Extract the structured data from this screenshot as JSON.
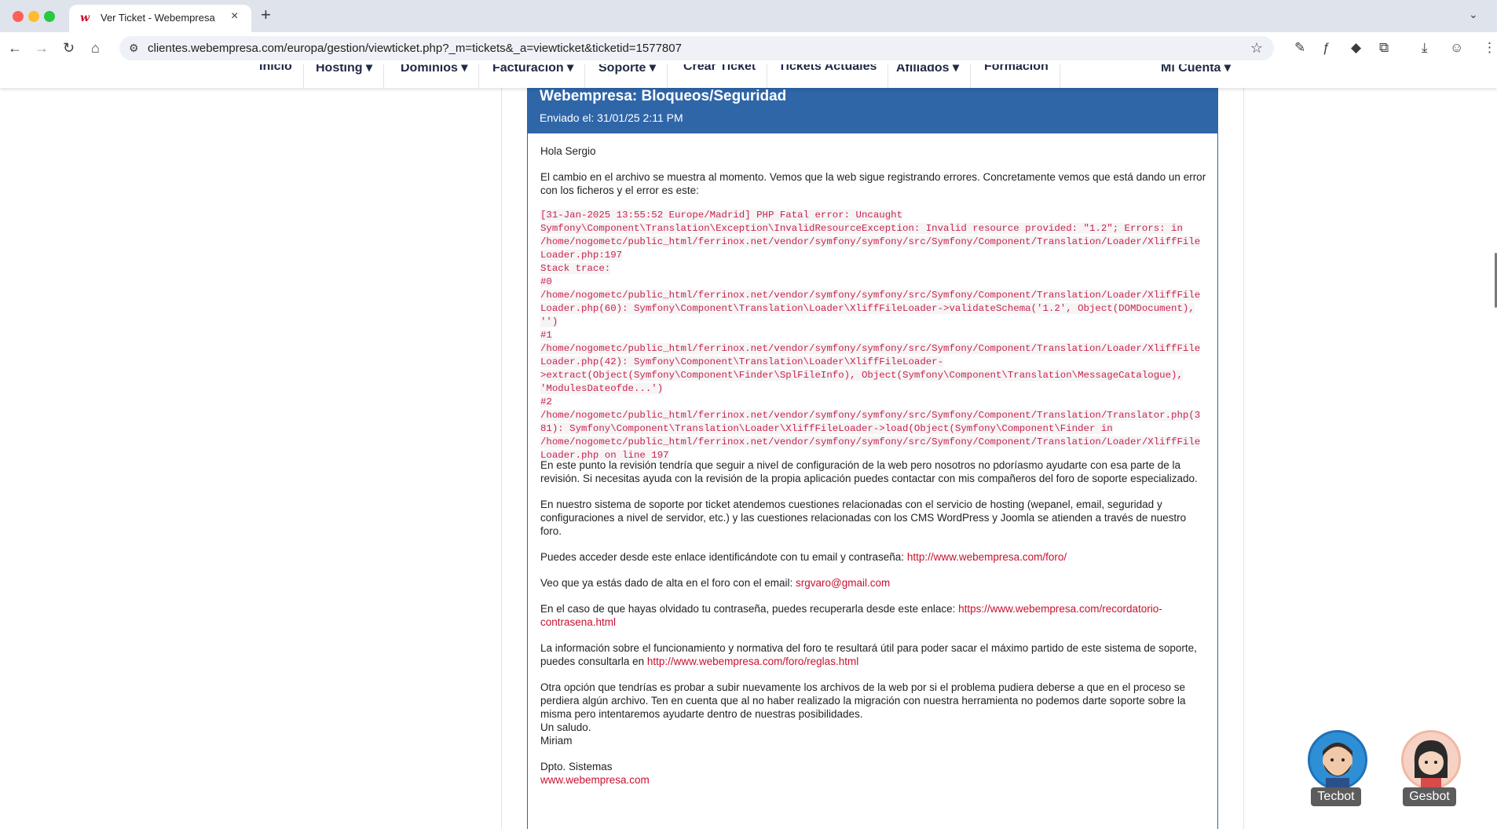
{
  "browser": {
    "tab_title": "Ver Ticket - Webempresa Europa",
    "tab_close": "×",
    "new_tab": "+",
    "url": "clientes.webempresa.com/europa/gestion/viewticket.php?_m=tickets&_a=viewticket&ticketid=1577807"
  },
  "site_nav": {
    "items": [
      "Inicio",
      "Hosting ▾",
      "Dominios ▾",
      "Facturación ▾",
      "Soporte ▾",
      "Crear Ticket",
      "Tickets Actuales",
      "Afiliados ▾",
      "Formación",
      "Mi Cuenta ▾"
    ]
  },
  "ticket": {
    "title": "Webempresa: Bloqueos/Seguridad",
    "sent": "Enviado el: 31/01/25 2:11 PM",
    "greeting": "Hola Sergio",
    "intro": "El cambio en el archivo se muestra al momento. Vemos que la web sigue registrando errores. Concretamente vemos que está dando un error con los ficheros y el error es este:",
    "code_lines": [
      "[31-Jan-2025 13:55:52 Europe/Madrid] PHP Fatal error: Uncaught",
      "Symfony\\Component\\Translation\\Exception\\InvalidResourceException: Invalid resource provided: \"1.2\"; Errors: in",
      "/home/nogometc/public_html/ferrinox.net/vendor/symfony/symfony/src/Symfony/Component/Translation/Loader/XliffFile",
      "Loader.php:197",
      "Stack trace:",
      "#0",
      "/home/nogometc/public_html/ferrinox.net/vendor/symfony/symfony/src/Symfony/Component/Translation/Loader/XliffFile",
      "Loader.php(60): Symfony\\Component\\Translation\\Loader\\XliffFileLoader->validateSchema('1.2', Object(DOMDocument),",
      "'')",
      "#1",
      "/home/nogometc/public_html/ferrinox.net/vendor/symfony/symfony/src/Symfony/Component/Translation/Loader/XliffFile",
      "Loader.php(42): Symfony\\Component\\Translation\\Loader\\XliffFileLoader-",
      ">extract(Object(Symfony\\Component\\Finder\\SplFileInfo), Object(Symfony\\Component\\Translation\\MessageCatalogue),",
      "'ModulesDateofde...')",
      "#2",
      "/home/nogometc/public_html/ferrinox.net/vendor/symfony/symfony/src/Symfony/Component/Translation/Translator.php(3",
      "81): Symfony\\Component\\Translation\\Loader\\XliffFileLoader->load(Object(Symfony\\Component\\Finder in",
      "/home/nogometc/public_html/ferrinox.net/vendor/symfony/symfony/src/Symfony/Component/Translation/Loader/XliffFile",
      "Loader.php on line 197"
    ],
    "para_review": "En este punto la revisión tendría que seguir a nivel de configuración de la web pero nosotros no pdoríasmo ayudarte con esa parte de la revisión. Si necesitas ayuda con la revisión de la propia aplicación puedes contactar con mis compañeros del foro de soporte especializado.",
    "para_system": "En nuestro sistema de soporte por ticket atendemos cuestiones relacionadas con el servicio de hosting (wepanel, email, seguridad y configuraciones a nivel de servidor, etc.) y las cuestiones relacionadas con los CMS WordPress y Joomla se atienden a través de nuestro foro.",
    "access_text": "Puedes acceder desde este enlace identificándote con tu email y contraseña: ",
    "access_link": "http://www.webempresa.com/foro/",
    "email_text": "Veo que ya estás dado de alta en el foro con el email: ",
    "email_link": "srgvaro@gmail.com",
    "password_text": "En el caso de que hayas olvidado tu contraseña, puedes recuperarla desde este enlace: ",
    "password_link": "https://www.webempresa.com/recordatorio-contrasena.html",
    "rules_text": "La información sobre el funcionamiento y normativa del foro te resultará útil para poder sacar el máximo partido de este sistema de soporte, puedes consultarla en ",
    "rules_link": "http://www.webempresa.com/foro/reglas.html",
    "other_option": "Otra opción que tendrías es probar a subir nuevamente los archivos de la web por si el problema pudiera deberse a que en el proceso se perdiera algún archivo. Ten en cuenta que al no haber realizado la migración con nuestra herramienta no podemos darte soporte sobre la misma pero intentaremos ayudarte dentro de nuestras posibilidades.",
    "closing": "Un saludo.",
    "signature_name": "Miriam",
    "department": "Dpto. Sistemas",
    "site_link": "www.webempresa.com"
  },
  "bots": {
    "tecbot": "Tecbot",
    "gesbot": "Gesbot"
  },
  "colors": {
    "header_blue": "#2f66a8",
    "link_red": "#c8102e",
    "code_red": "#c7254e"
  }
}
